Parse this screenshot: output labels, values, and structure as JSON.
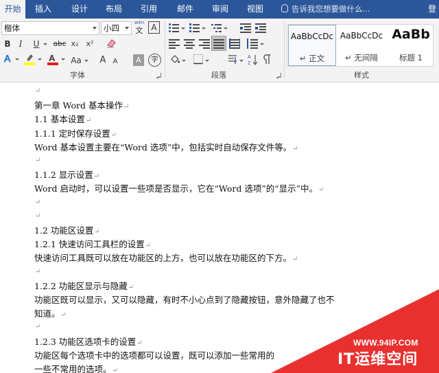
{
  "tabs": [
    "开始",
    "插入",
    "设计",
    "布局",
    "引用",
    "邮件",
    "审阅",
    "视图"
  ],
  "active_tab": "开始",
  "tell_me": "告诉我您想要做什么...",
  "sign_in": "登",
  "font": {
    "name": "楷体",
    "size": "小四",
    "wen_label": "wén",
    "wen_char": "文",
    "border_char": "A",
    "bold": "B",
    "italic": "I",
    "underline": "U",
    "strike": "abc",
    "subscript": "x₂",
    "superscript": "x²",
    "grow": "A",
    "shrink": "A",
    "case": "Aa",
    "shade_char": "A",
    "circle_char": "字",
    "group_label": "字体"
  },
  "paragraph": {
    "group_label": "段落"
  },
  "styles": {
    "group_label": "样式",
    "items": [
      {
        "sample": "AaBbCcDc",
        "name": "↵ 正文"
      },
      {
        "sample": "AaBbCcDc",
        "name": "↵ 无间隔"
      },
      {
        "sample": "AaBb",
        "name": "标题 1"
      }
    ]
  },
  "colors": {
    "title_bar": "#2b579a",
    "highlight": "#ffff00",
    "font_color": "#e0201b",
    "watermark": "#e8312f"
  },
  "document": {
    "lines": [
      {
        "text": "",
        "mark": "↵"
      },
      {
        "text": "第一章 Word 基本操作",
        "mark": "↵"
      },
      {
        "text": "1.1 基本设置",
        "mark": "↵"
      },
      {
        "text": "1.1.1 定时保存设置",
        "mark": "↵"
      },
      {
        "text": "Word 基本设置主要在“Word 选项”中，包括实时自动保存文件等。",
        "mark": "↵"
      },
      {
        "text": "",
        "mark": "↵"
      },
      {
        "text": "1.1.2 显示设置",
        "mark": "↵"
      },
      {
        "text": "Word 启动时，可以设置一些项是否显示，它在“Word 选项”的“显示”中。",
        "mark": "↵"
      },
      {
        "text": "",
        "mark": "↵"
      },
      {
        "text": "",
        "mark": "↵"
      },
      {
        "text": "1.2 功能区设置",
        "mark": "↵"
      },
      {
        "text": "1.2.1 快速访问工具栏的设置",
        "mark": "↵"
      },
      {
        "text": "快速访问工具既可以放在功能区的上方，也可以放在功能区的下方。",
        "mark": "↵"
      },
      {
        "text": "",
        "mark": "↵"
      },
      {
        "text": "1.2.2 功能区显示与隐藏",
        "mark": "↵"
      },
      {
        "text": "功能区既可以显示，又可以隐藏，有时不小心点到了隐藏按钮，意外隐藏了也不",
        "mark": ""
      },
      {
        "text": "知道。",
        "mark": "↵"
      },
      {
        "text": "",
        "mark": "↵"
      },
      {
        "text": "1.2.3 功能区选项卡的设置",
        "mark": "↵"
      },
      {
        "text": "功能区每个选项卡中的选项都可以设置，既可以添加一些常用的",
        "mark": ""
      },
      {
        "text": "一些不常用的选项。",
        "mark": "↵"
      }
    ]
  },
  "watermark": {
    "url": "WWW.94IP.COM",
    "brand": "IT运维空间"
  }
}
